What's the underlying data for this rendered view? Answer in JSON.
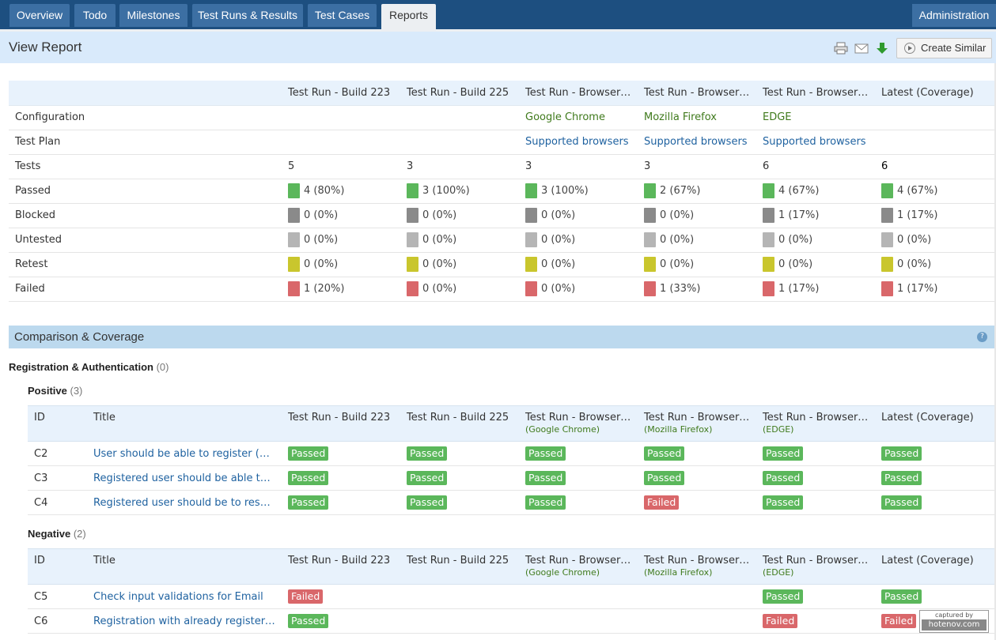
{
  "nav": {
    "tabs": [
      "Overview",
      "Todo",
      "Milestones",
      "Test Runs & Results",
      "Test Cases",
      "Reports"
    ],
    "active": "Reports",
    "admin": "Administration"
  },
  "header": {
    "title": "View Report",
    "create_similar": "Create Similar"
  },
  "colors": {
    "passed": "#5bb75b",
    "blocked": "#8a8a8a",
    "untested": "#b5b5b5",
    "retest": "#c9c62d",
    "failed": "#d9676a"
  },
  "summary": {
    "columns": [
      "Test Run - Build 223",
      "Test Run - Build 225",
      "Test Run - Browsers...",
      "Test Run - Browsers...",
      "Test Run - Browsers...",
      "Latest (Coverage)"
    ],
    "configuration_label": "Configuration",
    "configuration": [
      "",
      "",
      "Google Chrome",
      "Mozilla Firefox",
      "EDGE",
      ""
    ],
    "test_plan_label": "Test Plan",
    "test_plan": [
      "",
      "",
      "Supported browsers",
      "Supported browsers",
      "Supported browsers",
      ""
    ],
    "tests_label": "Tests",
    "tests": [
      "5",
      "3",
      "3",
      "3",
      "6",
      "6"
    ],
    "statuses": [
      {
        "label": "Passed",
        "key": "passed",
        "values": [
          "4 (80%)",
          "3 (100%)",
          "3 (100%)",
          "2 (67%)",
          "4 (67%)",
          "4 (67%)"
        ]
      },
      {
        "label": "Blocked",
        "key": "blocked",
        "values": [
          "0 (0%)",
          "0 (0%)",
          "0 (0%)",
          "0 (0%)",
          "1 (17%)",
          "1 (17%)"
        ]
      },
      {
        "label": "Untested",
        "key": "untested",
        "values": [
          "0 (0%)",
          "0 (0%)",
          "0 (0%)",
          "0 (0%)",
          "0 (0%)",
          "0 (0%)"
        ]
      },
      {
        "label": "Retest",
        "key": "retest",
        "values": [
          "0 (0%)",
          "0 (0%)",
          "0 (0%)",
          "0 (0%)",
          "0 (0%)",
          "0 (0%)"
        ]
      },
      {
        "label": "Failed",
        "key": "failed",
        "values": [
          "1 (20%)",
          "0 (0%)",
          "0 (0%)",
          "1 (33%)",
          "1 (17%)",
          "1 (17%)"
        ]
      }
    ]
  },
  "comparison": {
    "title": "Comparison & Coverage",
    "section": "Registration & Authentication",
    "section_count": "(0)",
    "headers": {
      "id": "ID",
      "title": "Title",
      "runs": [
        {
          "name": "Test Run - Build 223",
          "sub": ""
        },
        {
          "name": "Test Run - Build 225",
          "sub": ""
        },
        {
          "name": "Test Run - Browsers...",
          "sub": "(Google Chrome)"
        },
        {
          "name": "Test Run - Browsers...",
          "sub": "(Mozilla Firefox)"
        },
        {
          "name": "Test Run - Browsers...",
          "sub": "(EDGE)"
        },
        {
          "name": "Latest (Coverage)",
          "sub": ""
        }
      ]
    },
    "groups": [
      {
        "name": "Positive",
        "count": "(3)",
        "rows": [
          {
            "id": "C2",
            "title": "User should be able to register (via ...",
            "results": [
              "Passed",
              "Passed",
              "Passed",
              "Passed",
              "Passed",
              "Passed"
            ]
          },
          {
            "id": "C3",
            "title": "Registered user should be able to lo...",
            "results": [
              "Passed",
              "Passed",
              "Passed",
              "Passed",
              "Passed",
              "Passed"
            ]
          },
          {
            "id": "C4",
            "title": "Registered user should be to reset p...",
            "results": [
              "Passed",
              "Passed",
              "Passed",
              "Failed",
              "Passed",
              "Passed"
            ]
          }
        ]
      },
      {
        "name": "Negative",
        "count": "(2)",
        "rows": [
          {
            "id": "C5",
            "title": "Check input validations for Email",
            "results": [
              "Failed",
              "",
              "",
              "",
              "Passed",
              "Passed"
            ]
          },
          {
            "id": "C6",
            "title": "Registration with already registered ...",
            "results": [
              "Passed",
              "",
              "",
              "",
              "Failed",
              "Failed"
            ]
          }
        ]
      }
    ]
  },
  "watermark": {
    "line1": "captured by",
    "line2": "hotenov.com"
  }
}
